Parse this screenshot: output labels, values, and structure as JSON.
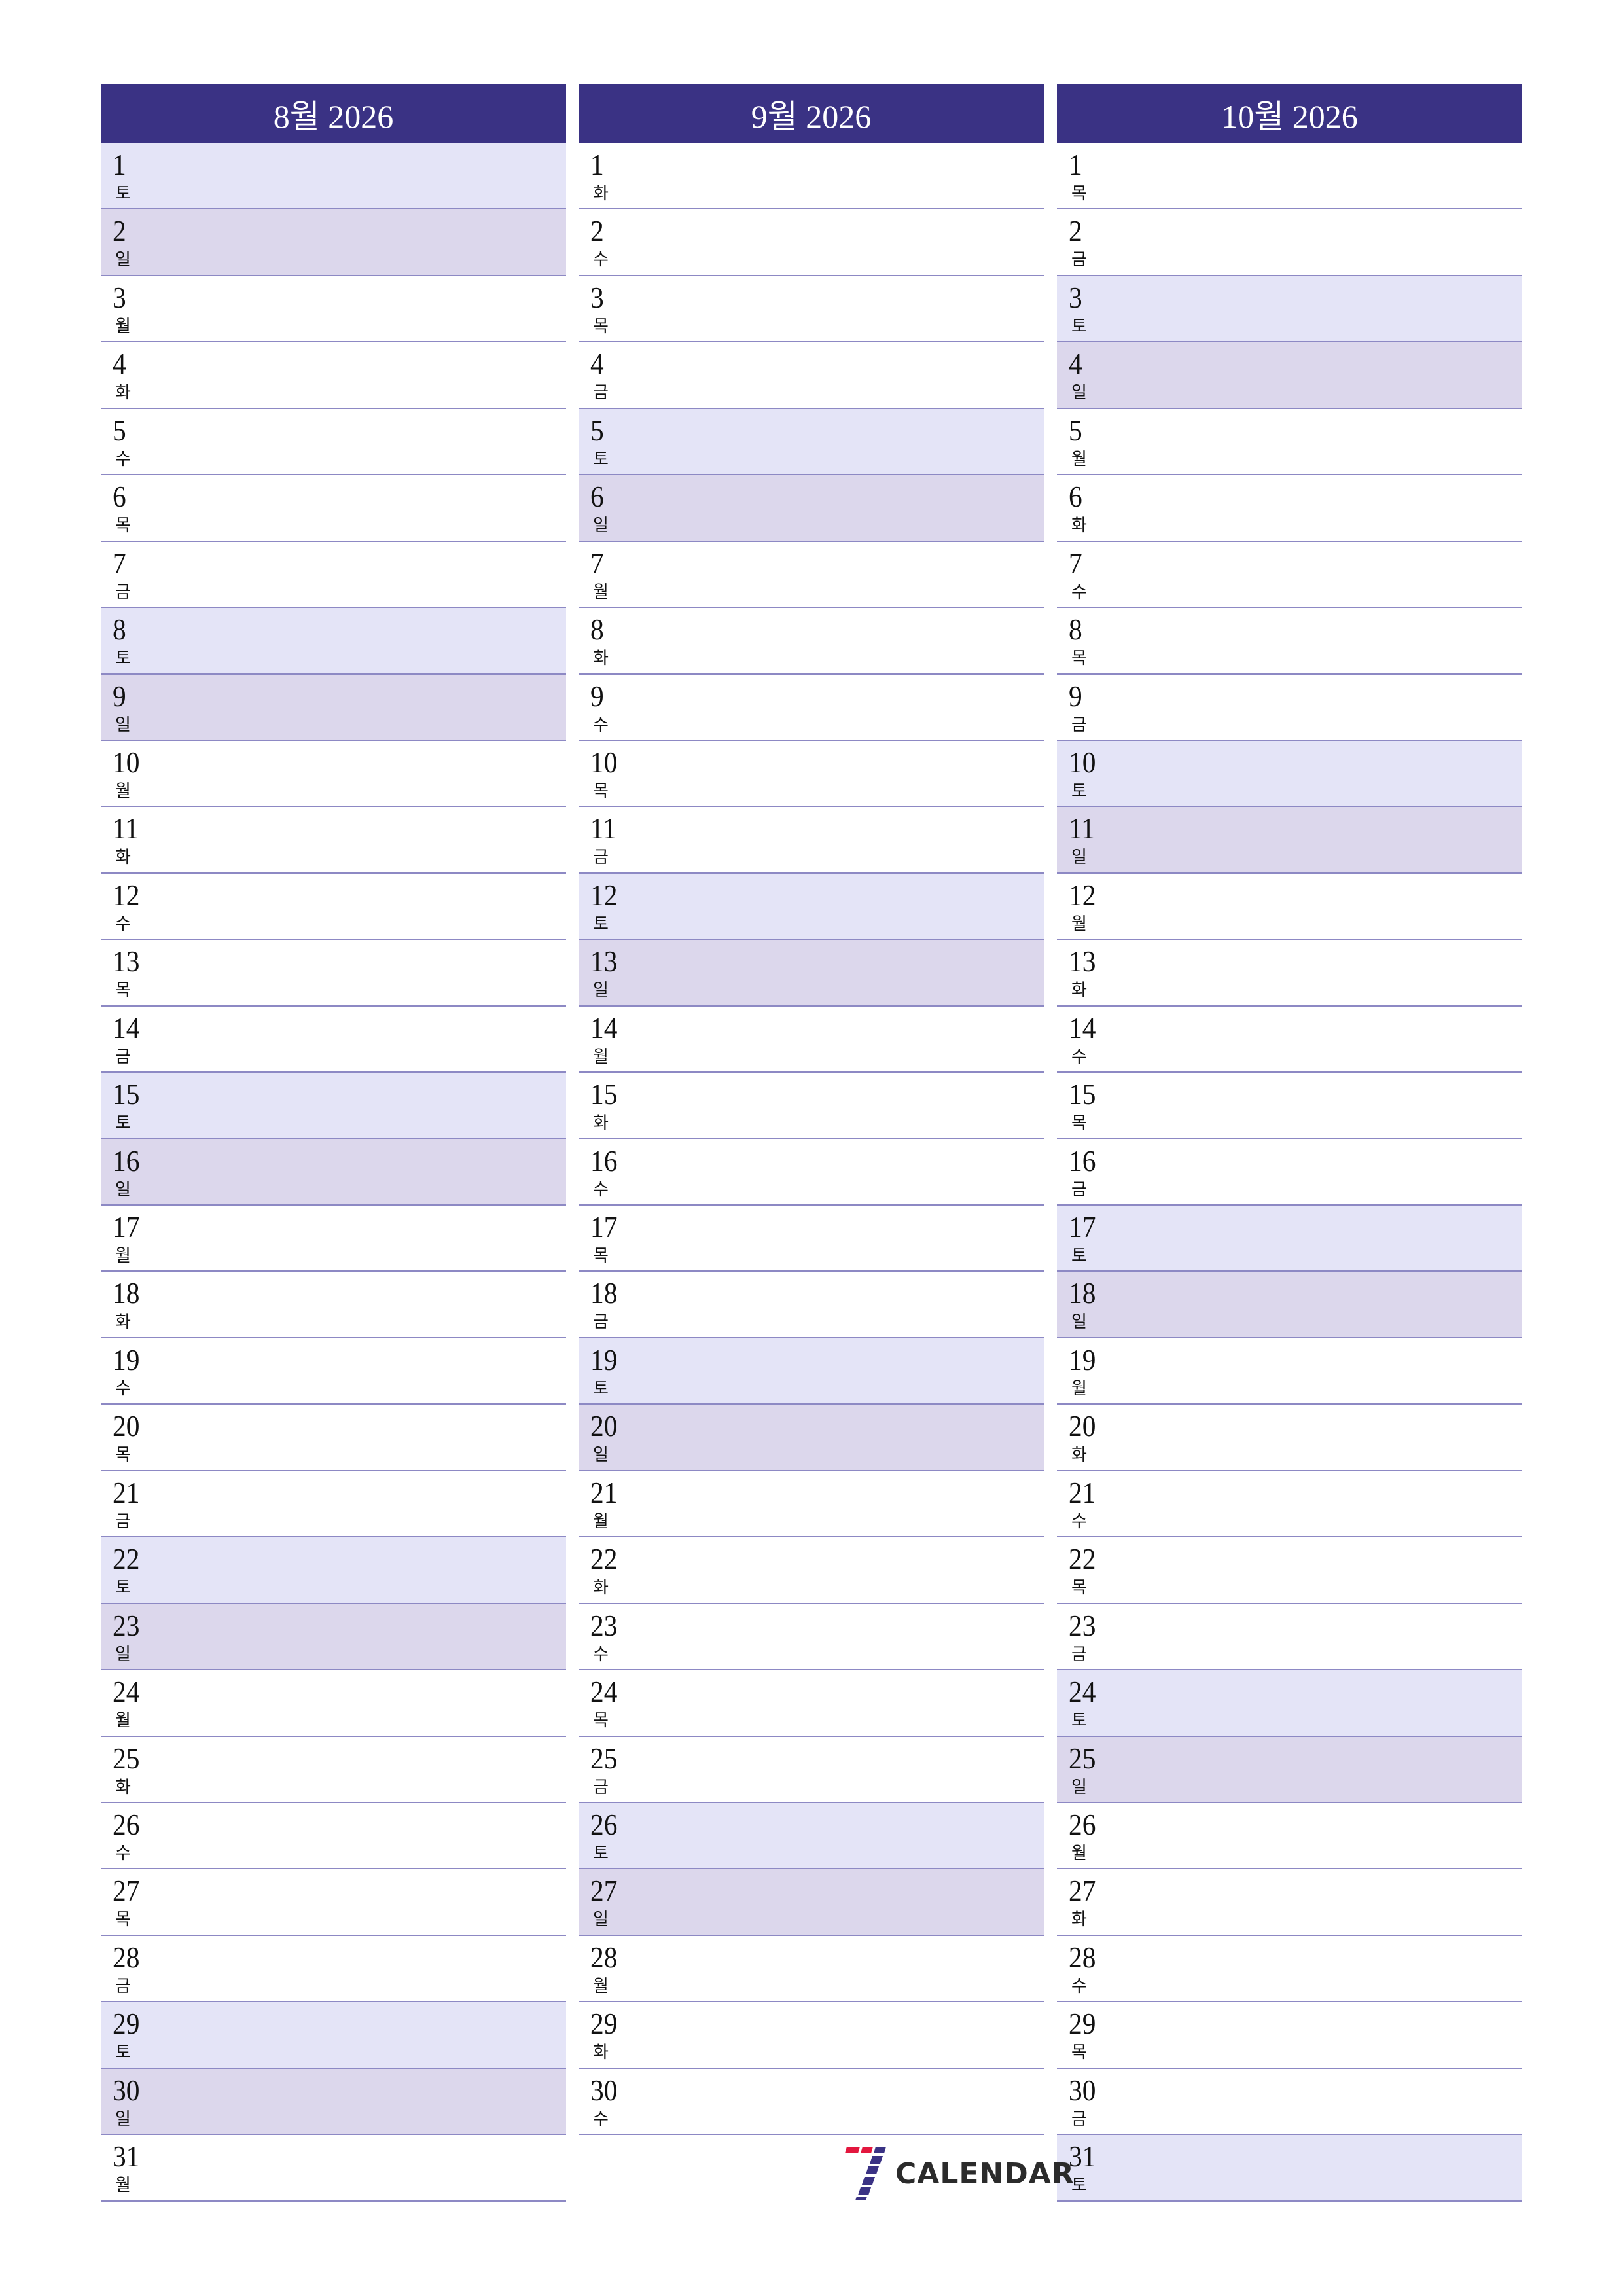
{
  "colors": {
    "header": "#3a3284",
    "saturday": "#e4e4f7",
    "sunday": "#dcd7ec",
    "divider": "#8d89c4",
    "logo_red": "#e3173e",
    "logo_blue": "#3a3284"
  },
  "logo": {
    "icon": "seven-calendar-logo-icon",
    "text": "CALENDAR"
  },
  "months": [
    {
      "title": "8월 2026",
      "days": [
        {
          "d": "1",
          "w": "토"
        },
        {
          "d": "2",
          "w": "일"
        },
        {
          "d": "3",
          "w": "월"
        },
        {
          "d": "4",
          "w": "화"
        },
        {
          "d": "5",
          "w": "수"
        },
        {
          "d": "6",
          "w": "목"
        },
        {
          "d": "7",
          "w": "금"
        },
        {
          "d": "8",
          "w": "토"
        },
        {
          "d": "9",
          "w": "일"
        },
        {
          "d": "10",
          "w": "월"
        },
        {
          "d": "11",
          "w": "화"
        },
        {
          "d": "12",
          "w": "수"
        },
        {
          "d": "13",
          "w": "목"
        },
        {
          "d": "14",
          "w": "금"
        },
        {
          "d": "15",
          "w": "토"
        },
        {
          "d": "16",
          "w": "일"
        },
        {
          "d": "17",
          "w": "월"
        },
        {
          "d": "18",
          "w": "화"
        },
        {
          "d": "19",
          "w": "수"
        },
        {
          "d": "20",
          "w": "목"
        },
        {
          "d": "21",
          "w": "금"
        },
        {
          "d": "22",
          "w": "토"
        },
        {
          "d": "23",
          "w": "일"
        },
        {
          "d": "24",
          "w": "월"
        },
        {
          "d": "25",
          "w": "화"
        },
        {
          "d": "26",
          "w": "수"
        },
        {
          "d": "27",
          "w": "목"
        },
        {
          "d": "28",
          "w": "금"
        },
        {
          "d": "29",
          "w": "토"
        },
        {
          "d": "30",
          "w": "일"
        },
        {
          "d": "31",
          "w": "월"
        }
      ]
    },
    {
      "title": "9월 2026",
      "days": [
        {
          "d": "1",
          "w": "화"
        },
        {
          "d": "2",
          "w": "수"
        },
        {
          "d": "3",
          "w": "목"
        },
        {
          "d": "4",
          "w": "금"
        },
        {
          "d": "5",
          "w": "토"
        },
        {
          "d": "6",
          "w": "일"
        },
        {
          "d": "7",
          "w": "월"
        },
        {
          "d": "8",
          "w": "화"
        },
        {
          "d": "9",
          "w": "수"
        },
        {
          "d": "10",
          "w": "목"
        },
        {
          "d": "11",
          "w": "금"
        },
        {
          "d": "12",
          "w": "토"
        },
        {
          "d": "13",
          "w": "일"
        },
        {
          "d": "14",
          "w": "월"
        },
        {
          "d": "15",
          "w": "화"
        },
        {
          "d": "16",
          "w": "수"
        },
        {
          "d": "17",
          "w": "목"
        },
        {
          "d": "18",
          "w": "금"
        },
        {
          "d": "19",
          "w": "토"
        },
        {
          "d": "20",
          "w": "일"
        },
        {
          "d": "21",
          "w": "월"
        },
        {
          "d": "22",
          "w": "화"
        },
        {
          "d": "23",
          "w": "수"
        },
        {
          "d": "24",
          "w": "목"
        },
        {
          "d": "25",
          "w": "금"
        },
        {
          "d": "26",
          "w": "토"
        },
        {
          "d": "27",
          "w": "일"
        },
        {
          "d": "28",
          "w": "월"
        },
        {
          "d": "29",
          "w": "화"
        },
        {
          "d": "30",
          "w": "수"
        }
      ]
    },
    {
      "title": "10월 2026",
      "days": [
        {
          "d": "1",
          "w": "목"
        },
        {
          "d": "2",
          "w": "금"
        },
        {
          "d": "3",
          "w": "토"
        },
        {
          "d": "4",
          "w": "일"
        },
        {
          "d": "5",
          "w": "월"
        },
        {
          "d": "6",
          "w": "화"
        },
        {
          "d": "7",
          "w": "수"
        },
        {
          "d": "8",
          "w": "목"
        },
        {
          "d": "9",
          "w": "금"
        },
        {
          "d": "10",
          "w": "토"
        },
        {
          "d": "11",
          "w": "일"
        },
        {
          "d": "12",
          "w": "월"
        },
        {
          "d": "13",
          "w": "화"
        },
        {
          "d": "14",
          "w": "수"
        },
        {
          "d": "15",
          "w": "목"
        },
        {
          "d": "16",
          "w": "금"
        },
        {
          "d": "17",
          "w": "토"
        },
        {
          "d": "18",
          "w": "일"
        },
        {
          "d": "19",
          "w": "월"
        },
        {
          "d": "20",
          "w": "화"
        },
        {
          "d": "21",
          "w": "수"
        },
        {
          "d": "22",
          "w": "목"
        },
        {
          "d": "23",
          "w": "금"
        },
        {
          "d": "24",
          "w": "토"
        },
        {
          "d": "25",
          "w": "일"
        },
        {
          "d": "26",
          "w": "월"
        },
        {
          "d": "27",
          "w": "화"
        },
        {
          "d": "28",
          "w": "수"
        },
        {
          "d": "29",
          "w": "목"
        },
        {
          "d": "30",
          "w": "금"
        },
        {
          "d": "31",
          "w": "토"
        }
      ]
    }
  ]
}
